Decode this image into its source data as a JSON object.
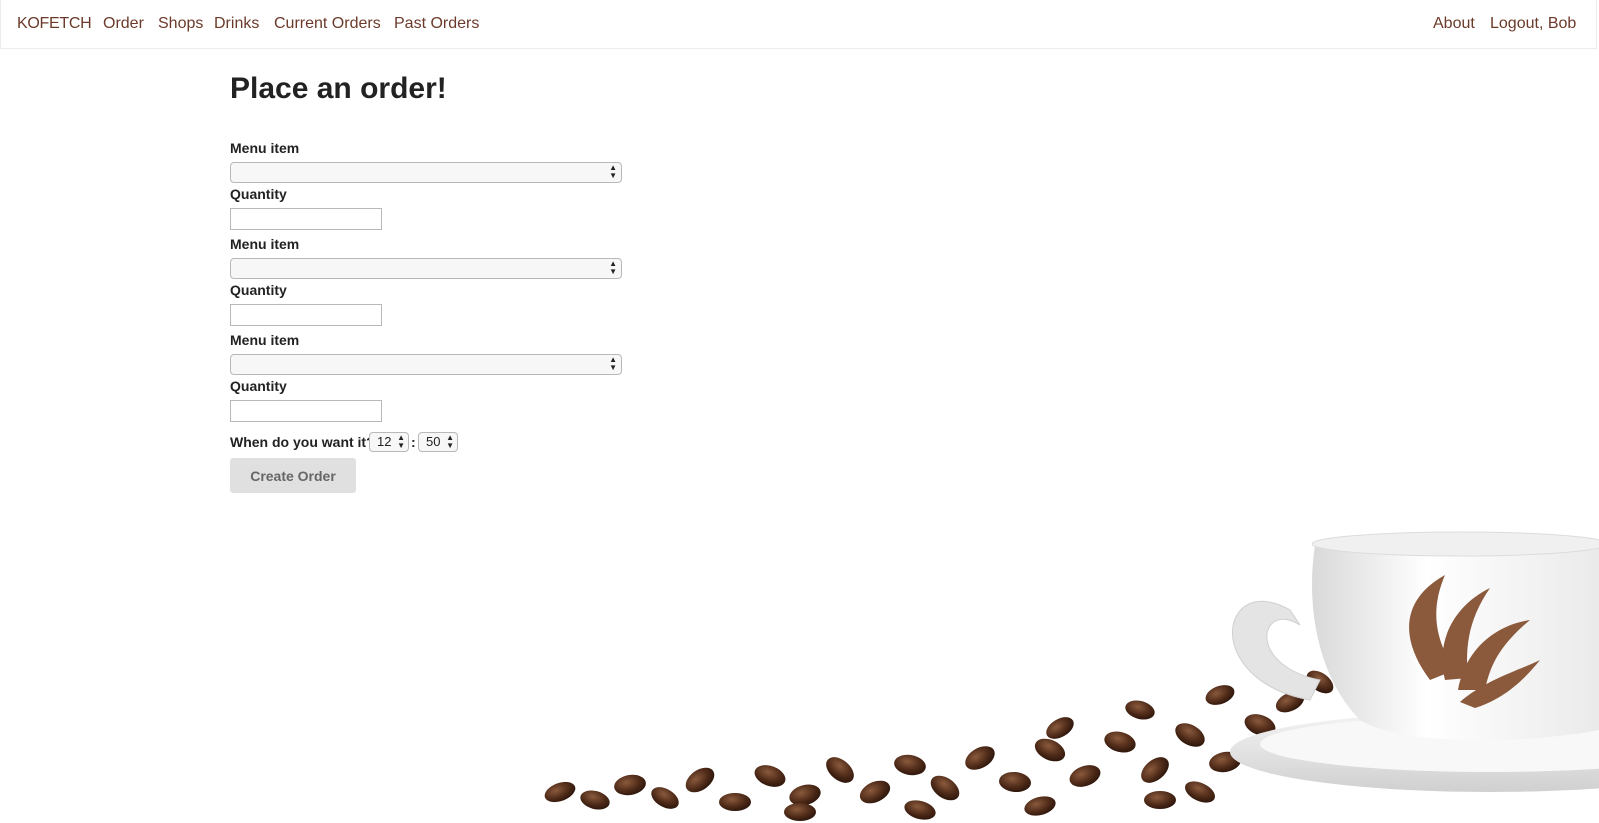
{
  "nav": {
    "brand": "KOFETCH",
    "left_links": [
      "Order",
      "Shops",
      "Drinks",
      "Current Orders",
      "Past Orders"
    ],
    "right_links": [
      "About",
      "Logout, Bob"
    ]
  },
  "page": {
    "title": "Place an order!"
  },
  "form": {
    "rows": [
      {
        "menu_label": "Menu item",
        "menu_value": "",
        "qty_label": "Quantity",
        "qty_value": ""
      },
      {
        "menu_label": "Menu item",
        "menu_value": "",
        "qty_label": "Quantity",
        "qty_value": ""
      },
      {
        "menu_label": "Menu item",
        "menu_value": "",
        "qty_label": "Quantity",
        "qty_value": ""
      }
    ],
    "when_label": "When do you want it?",
    "hour": "12",
    "minute": "50",
    "separator": ":",
    "submit_label": "Create Order"
  },
  "colors": {
    "link": "#6b3a2a",
    "button_bg": "#e0e0e0"
  },
  "icons": {
    "select_arrows": "updown-arrows-icon"
  }
}
